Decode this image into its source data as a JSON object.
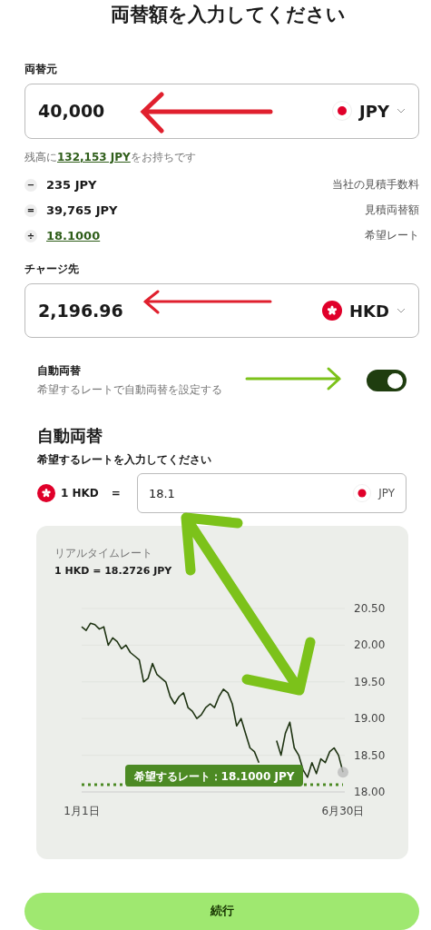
{
  "title": "両替額を入力してください",
  "source": {
    "label": "両替元",
    "amount": "40,000",
    "currency": "JPY",
    "kind": "jp"
  },
  "balance": {
    "before": "残高に",
    "link": "132,153 JPY",
    "after": "をお持ちです"
  },
  "breakdown": [
    {
      "symbol": "−",
      "value": "235 JPY",
      "label": "当社の見積手数料",
      "kind": "plain"
    },
    {
      "symbol": "=",
      "value": "39,765 JPY",
      "label": "見積両替額",
      "kind": "plain"
    },
    {
      "symbol": "÷",
      "value": "18.1000",
      "label": "希望レート",
      "kind": "link"
    }
  ],
  "target": {
    "label": "チャージ先",
    "amount": "2,196.96",
    "currency": "HKD",
    "kind": "hk"
  },
  "auto_exchange": {
    "title": "自動両替",
    "description": "希望するレートで自動両替を設定する",
    "on": true
  },
  "auto_section": {
    "heading": "自動両替",
    "prompt": "希望するレートを入力してください",
    "base": {
      "text": "1 HKD",
      "kind": "hk"
    },
    "equals": "=",
    "rate_value": "18.1",
    "quote": {
      "text": "JPY",
      "kind": "jp"
    }
  },
  "chart": {
    "caption": "リアルタイムレート",
    "current": "1 HKD = 18.2726 JPY",
    "chart_data": {
      "type": "line",
      "categories": [
        "1月1日",
        null,
        null,
        null,
        null,
        null,
        null,
        null,
        null,
        null,
        null,
        null,
        null,
        null,
        null,
        null,
        null,
        null,
        null,
        null,
        null,
        null,
        null,
        null,
        null,
        null,
        null,
        null,
        null,
        null,
        null,
        null,
        null,
        null,
        null,
        null,
        null,
        null,
        null,
        null,
        null,
        null,
        null,
        null,
        null,
        null,
        null,
        null,
        null,
        null,
        null,
        null,
        null,
        null,
        null,
        null,
        null,
        null,
        null,
        "6月30日"
      ],
      "series": [
        {
          "color": "#1e3312",
          "values": [
            20.25,
            20.2,
            20.3,
            20.28,
            20.22,
            20.25,
            20.0,
            20.1,
            20.05,
            19.95,
            20.0,
            19.9,
            19.85,
            19.8,
            19.5,
            19.55,
            19.75,
            19.6,
            19.55,
            19.5,
            19.3,
            19.2,
            19.3,
            19.35,
            19.15,
            19.1,
            19.0,
            19.05,
            19.15,
            19.2,
            19.15,
            19.3,
            19.4,
            19.35,
            19.2,
            18.9,
            19.0,
            18.8,
            18.6,
            18.55,
            18.4,
            null,
            null,
            null,
            18.7,
            18.5,
            18.8,
            18.95,
            18.6,
            18.5,
            18.3,
            18.2,
            18.4,
            18.25,
            18.45,
            18.4,
            18.55,
            18.6,
            18.5,
            18.27
          ]
        }
      ],
      "ylim": [
        18,
        20.5
      ],
      "yticks": [
        {
          "value": 18,
          "label": "18.00"
        },
        {
          "value": 18.5,
          "label": "18.50"
        },
        {
          "value": 19,
          "label": "19.00"
        },
        {
          "value": 19.5,
          "label": "19.50"
        },
        {
          "value": 20,
          "label": "20.00"
        },
        {
          "value": 20.5,
          "label": "20.50"
        }
      ],
      "grid": true,
      "ref_lines": [
        {
          "axis": "y",
          "value": 18.1,
          "color": "#4c8a24",
          "label": "希望するレート：18.1000 JPY"
        }
      ]
    }
  },
  "continue_button": "続行"
}
